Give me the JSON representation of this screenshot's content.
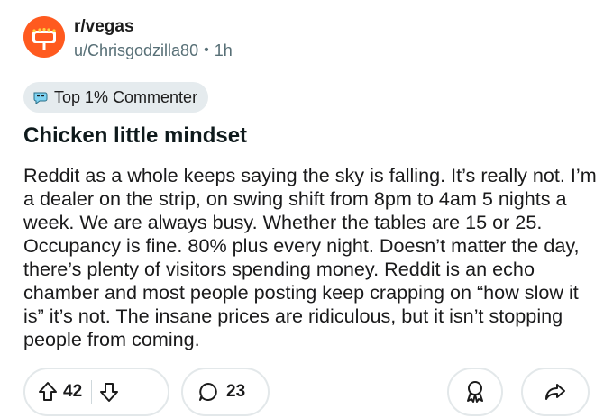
{
  "post": {
    "subreddit": "r/vegas",
    "author": "u/Chrisgodzilla80",
    "separator": "•",
    "age": "1h",
    "flair": "Top 1% Commenter",
    "title": "Chicken little mindset",
    "body": "Reddit as a whole keeps saying the sky is falling. It’s really not. I’m a dealer on the strip, on swing shift from 8pm to 4am 5 nights a week. We are always busy. Whether the tables are 15 or 25. Occupancy is fine. 80% plus every night. Doesn’t matter the day, there’s plenty of visitors spending money. Reddit is an echo chamber and most people posting keep crapping on “how slow it is” it’s not. The insane prices are ridiculous, but it isn’t stopping people from coming."
  },
  "actions": {
    "upvotes": "42",
    "comments": "23"
  },
  "icons": {
    "avatar": "vegas-sign-avatar-icon",
    "flair": "commenter-badge-icon",
    "upvote": "arrow-up-icon",
    "downvote": "arrow-down-icon",
    "comment": "speech-bubble-icon",
    "award": "award-icon",
    "share": "share-arrow-icon"
  },
  "colors": {
    "avatar_bg": "#ff5a1f",
    "badge_bg": "#e5ebee",
    "muted_text": "#576f76",
    "pill_border": "#e3e8ea"
  }
}
